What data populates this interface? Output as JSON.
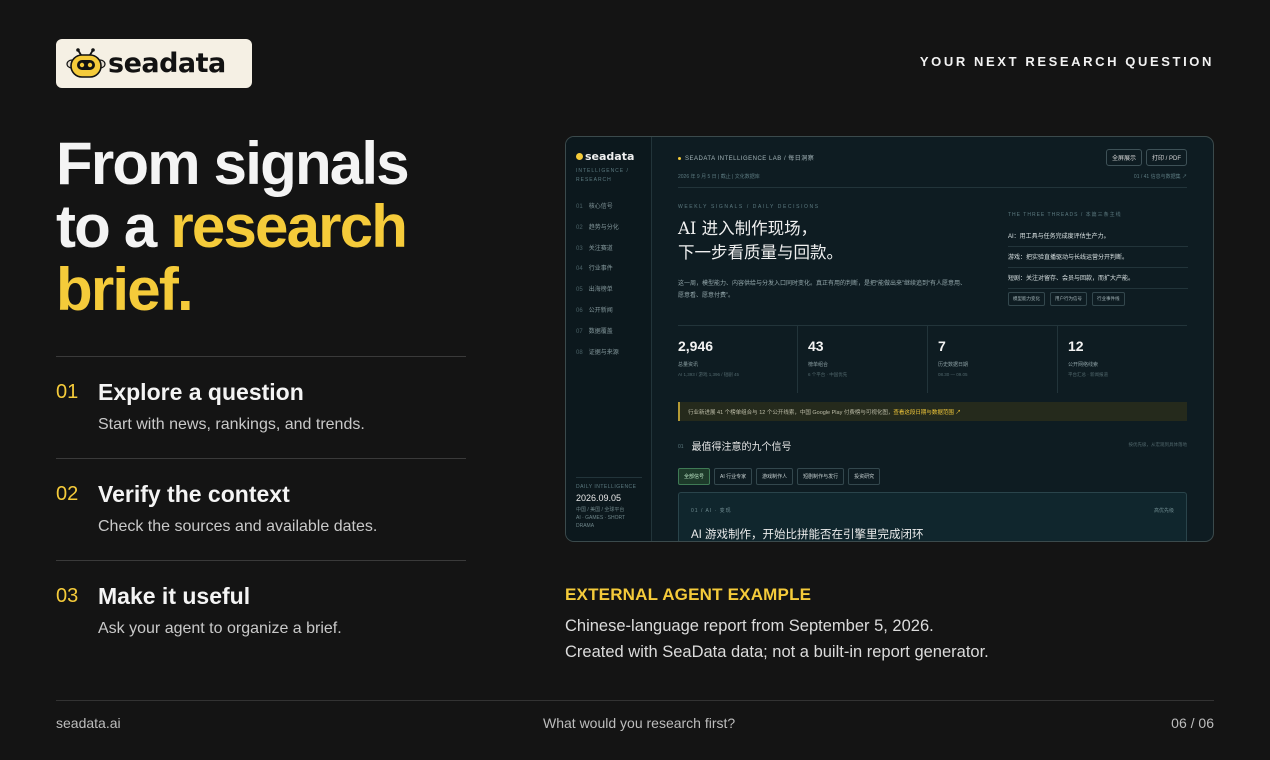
{
  "brand": {
    "name": "seadata",
    "logo_icon": "bee-icon",
    "accent": "#f5cb3a",
    "background": "#141414"
  },
  "eyebrow": "YOUR NEXT RESEARCH QUESTION",
  "headline": {
    "line1": "From signals",
    "line2_plain": "to a ",
    "line2_highlight": "research",
    "line3_highlight": "brief."
  },
  "steps": [
    {
      "num": "01",
      "title": "Explore a question",
      "desc": "Start with news, rankings, and trends."
    },
    {
      "num": "02",
      "title": "Verify the context",
      "desc": "Check the sources and available dates."
    },
    {
      "num": "03",
      "title": "Make it useful",
      "desc": "Ask your agent to organize a brief."
    }
  ],
  "report": {
    "brand": "seadata",
    "brand_sub1": "INTELLIGENCE /",
    "brand_sub2": "RESEARCH",
    "nav": [
      {
        "n": "01",
        "label": "核心信号"
      },
      {
        "n": "02",
        "label": "趋势与分化"
      },
      {
        "n": "03",
        "label": "关注赛道"
      },
      {
        "n": "04",
        "label": "行业事件"
      },
      {
        "n": "05",
        "label": "出海榜单"
      },
      {
        "n": "06",
        "label": "公开新闻"
      },
      {
        "n": "07",
        "label": "数据覆盖"
      },
      {
        "n": "08",
        "label": "证据与来源"
      }
    ],
    "side_foot": {
      "kicker": "DAILY INTELLIGENCE",
      "date": "2026.09.05",
      "meta1": "中国 / 美国 / 全球平台",
      "meta2": "AI · GAMES · SHORT",
      "meta3": "DRAMA"
    },
    "topline": "SEADATA INTELLIGENCE LAB / 每日洞察",
    "dateline": "2026 年 9 月 5 日 | 截止 | 文化数据库",
    "buttons": [
      "全屏展示",
      "打印 / PDF"
    ],
    "pages": "01 / 41 信息与数据集 ↗",
    "weekly": "WEEKLY SIGNALS / DAILY DECISIONS",
    "title1": "AI 进入制作现场，",
    "title2": "下一步看质量与回款。",
    "lede": "这一周，模型能力、内容供给与分发入口同时变化。真正有用的判断，是把“能做出来”继续追到“有人愿意用、愿意看、愿意付费”。",
    "threads_kicker": "THE THREE THREADS / 本篇三条主线",
    "threads": [
      "AI：用工具与任务完成度评估生产力。",
      "游戏：把实验直播驱动与长线运营分开判断。",
      "短剧：关注对留存、会员与回款，而扩大产能。"
    ],
    "chips": [
      "模型能力变化",
      "用户行为信号",
      "行业事件线"
    ],
    "stats": [
      {
        "value": "2,946",
        "label": "总量资讯",
        "sub": "AI 1,393 / 游戏 1,396 / 短剧 45"
      },
      {
        "value": "43",
        "label": "榜单组合",
        "sub": "6 个平台 · 中国优先"
      },
      {
        "value": "7",
        "label": "历史数据日期",
        "sub": "08.30 — 09.05"
      },
      {
        "value": "12",
        "label": "公开网络线索",
        "sub": "平台汇总 · 新闻报道"
      }
    ],
    "banner_text": "行业新进展 41 个榜单组合与 12 个公开线索，中国 Google Play 付费榜与可视化图，",
    "banner_link": "查看这段日期与数据范围 ↗",
    "section_num": "01",
    "section_title": "最值得注意的九个信号",
    "section_right": "按优先级，从宏观到具体落地",
    "tabs": [
      "全部信号",
      "AI 行业专家",
      "游戏制作人",
      "短剧制作与发行",
      "投资研究"
    ],
    "card_kicker": "01 / AI · 变现",
    "card_right": "高优先级",
    "card_title": "AI 游戏制作，开始比拼能否在引擎里完成闭环"
  },
  "caption": {
    "kicker": "EXTERNAL AGENT EXAMPLE",
    "line1": "Chinese-language report from September 5, 2026.",
    "line2": "Created with SeaData data; not a built-in report generator."
  },
  "footer": {
    "left": "seadata.ai",
    "center": "What would you research first?",
    "right": "06 / 06"
  }
}
